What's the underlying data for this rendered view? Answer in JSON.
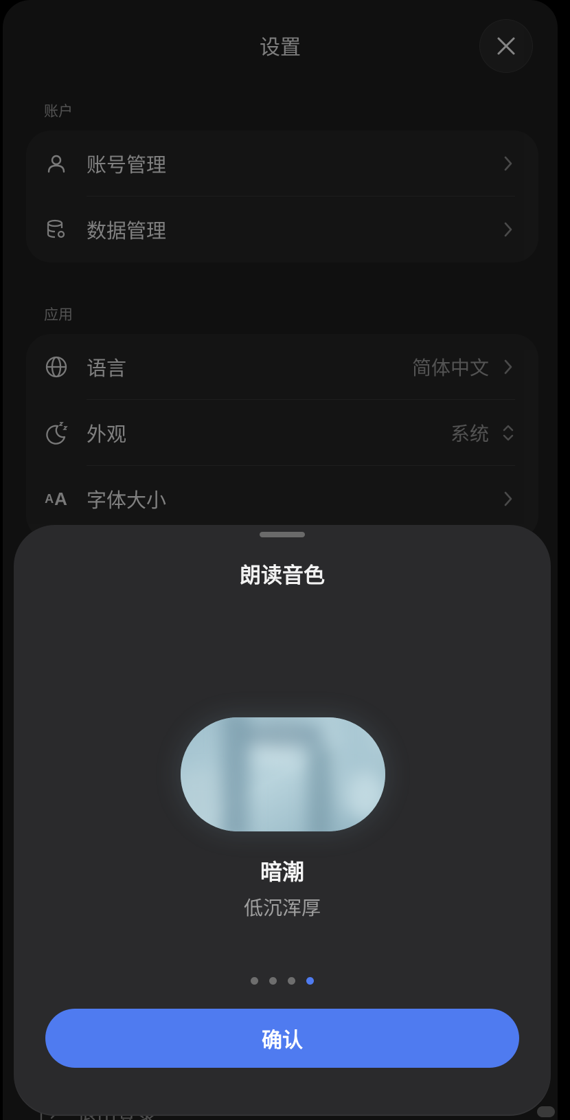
{
  "header": {
    "title": "设置",
    "close_icon": "close-icon"
  },
  "account_section": {
    "label": "账户",
    "items": [
      {
        "icon": "person-icon",
        "label": "账号管理"
      },
      {
        "icon": "database-gear-icon",
        "label": "数据管理"
      }
    ]
  },
  "app_section": {
    "label": "应用",
    "items": [
      {
        "icon": "globe-icon",
        "label": "语言",
        "value": "简体中文"
      },
      {
        "icon": "moon-zzz-icon",
        "label": "外观",
        "value": "系统"
      },
      {
        "icon": "font-size-icon",
        "label": "字体大小",
        "icon_text_small": "A",
        "icon_text_big": "A"
      }
    ]
  },
  "peek": {
    "label": "退出登录",
    "icon": "logout-icon"
  },
  "sheet": {
    "title": "朗读音色",
    "voice": {
      "name": "暗潮",
      "description": "低沉浑厚"
    },
    "pages": 4,
    "active_page": 4,
    "confirm_label": "确认"
  },
  "colors": {
    "accent": "#4f7bf0",
    "background": "#101010",
    "sheet": "#2a2a2c"
  }
}
